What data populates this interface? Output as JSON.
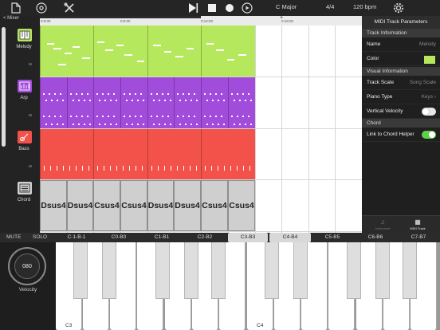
{
  "toolbar": {
    "icons": [
      "new-file-icon",
      "disc-icon",
      "tools-icon",
      "play-icon",
      "stop-icon",
      "record-icon",
      "metronome-icon",
      "settings-icon"
    ],
    "key_signature": "C Major",
    "time_signature": "4/4",
    "tempo": "120 bpm"
  },
  "mixer": {
    "back_label": "< Mixer"
  },
  "timeline": {
    "ticks": [
      "0:0:00",
      "0:6:00",
      "0:12:00",
      "0:18:00"
    ],
    "playhead_glyph": "+"
  },
  "tracks": [
    {
      "name": "Melody",
      "color": "#b6e85e",
      "mute_label": "M"
    },
    {
      "name": "Arp",
      "color": "#a24cdc",
      "mute_label": "M"
    },
    {
      "name": "Bass",
      "color": "#f2524a",
      "mute_label": "M"
    },
    {
      "name": "Chord",
      "color": "#cfcfcf",
      "mute_label": "M"
    }
  ],
  "chord_clips": [
    "Dsus4",
    "Dsus4",
    "Csus4",
    "Csus4",
    "Dsus4",
    "Dsus4",
    "Csus4",
    "Csus4"
  ],
  "panel": {
    "title": "MIDI Track Parameters",
    "sections": {
      "track_info": "Track Information",
      "visual_info": "Visual Information",
      "chord": "Chord"
    },
    "name_label": "Name",
    "name_value": "Melody",
    "color_label": "Color",
    "color_value": "#b6e85e",
    "track_scale_label": "Track Scale",
    "track_scale_value": "Song Scale",
    "piano_type_label": "Piano Type",
    "piano_type_value": "Keys",
    "vertical_velocity_label": "Vertical Velocity",
    "vertical_velocity_on": false,
    "link_chord_label": "Link to Chord Helper",
    "link_chord_on": true,
    "tabs": [
      {
        "label": "Instrument",
        "active": false
      },
      {
        "label": "MIDI Track",
        "active": true
      }
    ]
  },
  "keyboard": {
    "mute_label": "MUTE",
    "solo_label": "SOLO",
    "octaves": [
      "C-1-B-1",
      "C0-B0",
      "C1-B1",
      "C2-B2",
      "C3-B3",
      "C4-B4",
      "C5-B5",
      "C6-B6",
      "C7-B7"
    ],
    "selected_octaves": [
      "C3-B3",
      "C4-B4"
    ],
    "velocity_value": "080",
    "velocity_label": "Velocity",
    "key_labels": {
      "c3": "C3",
      "c4": "C4"
    }
  }
}
